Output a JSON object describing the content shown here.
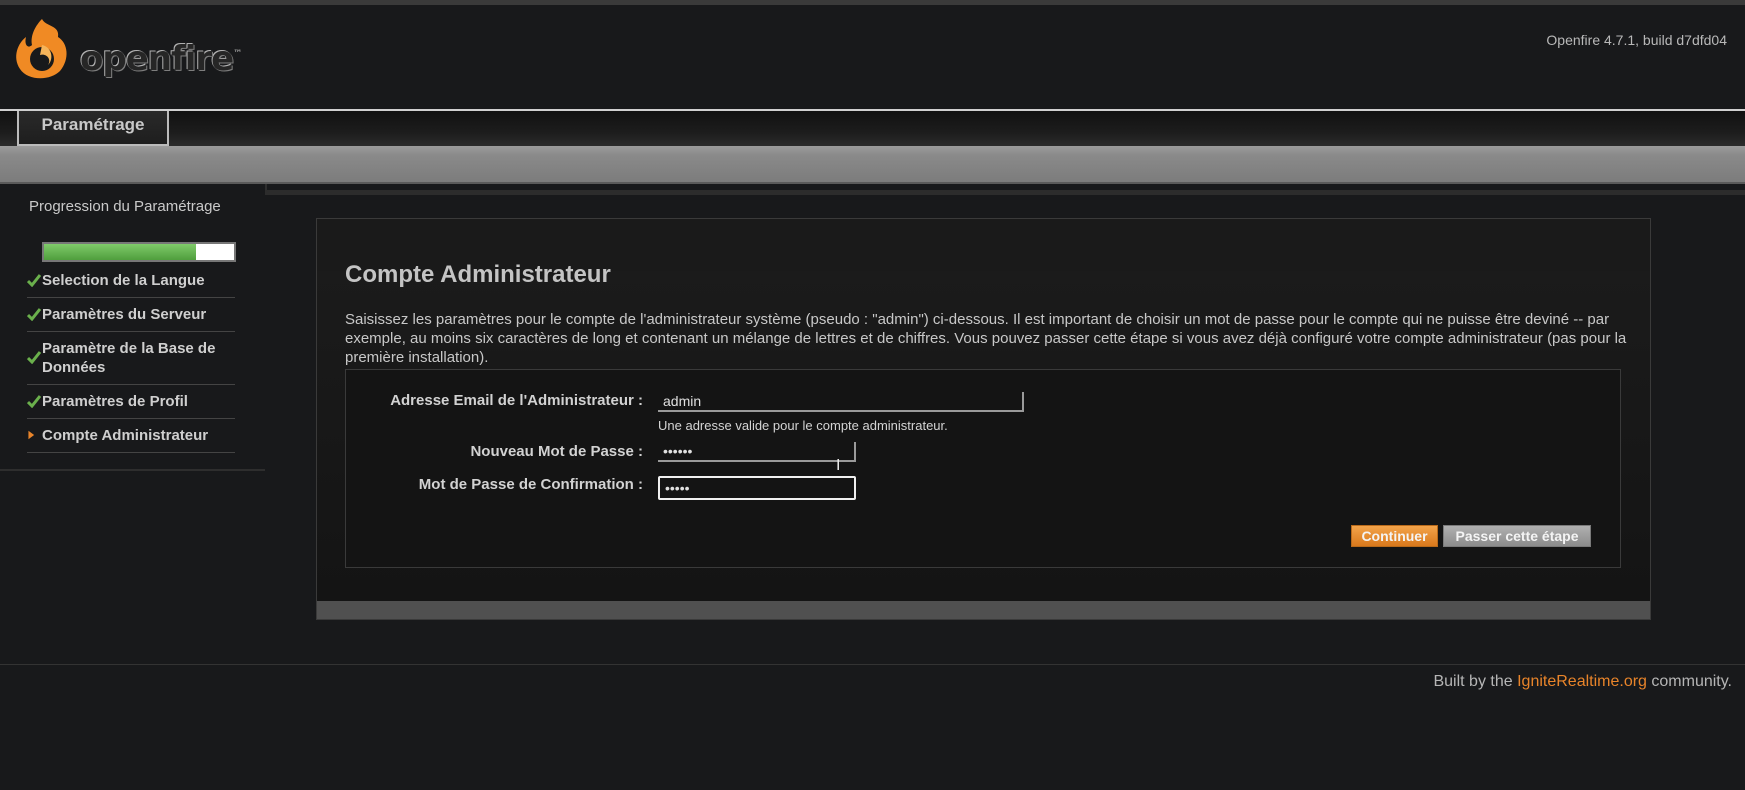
{
  "header": {
    "logo_text": "openfire",
    "logo_mark": "™",
    "version": "Openfire 4.7.1, build d7dfd04"
  },
  "tabs": [
    {
      "label": "Paramétrage"
    }
  ],
  "sidebar": {
    "progress_title": "Progression du Paramétrage",
    "progress_fraction": 0.8,
    "steps": [
      {
        "label": "Selection de la Langue",
        "status": "done"
      },
      {
        "label": "Paramètres du Serveur",
        "status": "done"
      },
      {
        "label": "Paramètre de la Base de Données",
        "status": "done"
      },
      {
        "label": "Paramètres de Profil",
        "status": "done"
      },
      {
        "label": "Compte Administrateur",
        "status": "current"
      }
    ]
  },
  "main": {
    "title": "Compte Administrateur",
    "intro": "Saisissez les paramètres pour le compte de l'administrateur système (pseudo : \"admin\") ci-dessous. Il est important de choisir un mot de passe pour le compte qui ne puisse être deviné -- par exemple, au moins six caractères de long et contenant un mélange de lettres et de chiffres. Vous pouvez passer cette étape si vous avez déjà configuré votre compte administrateur (pas pour la première installation).",
    "form": {
      "email_label": "Adresse Email de l'Administrateur :",
      "email_value": "admin",
      "email_hint": "Une adresse valide pour le compte administrateur.",
      "password_label": "Nouveau Mot de Passe :",
      "password_value": "••••••",
      "confirm_label": "Mot de Passe de Confirmation :",
      "confirm_value": "•••••"
    },
    "buttons": {
      "continue": "Continuer",
      "skip": "Passer cette étape"
    }
  },
  "footer": {
    "prefix": "Built by the ",
    "link": "IgniteRealtime.org",
    "suffix": " community."
  },
  "colors": {
    "accent": "#e8842a",
    "progress": "#5eaf4a",
    "check": "#6ab04c"
  }
}
